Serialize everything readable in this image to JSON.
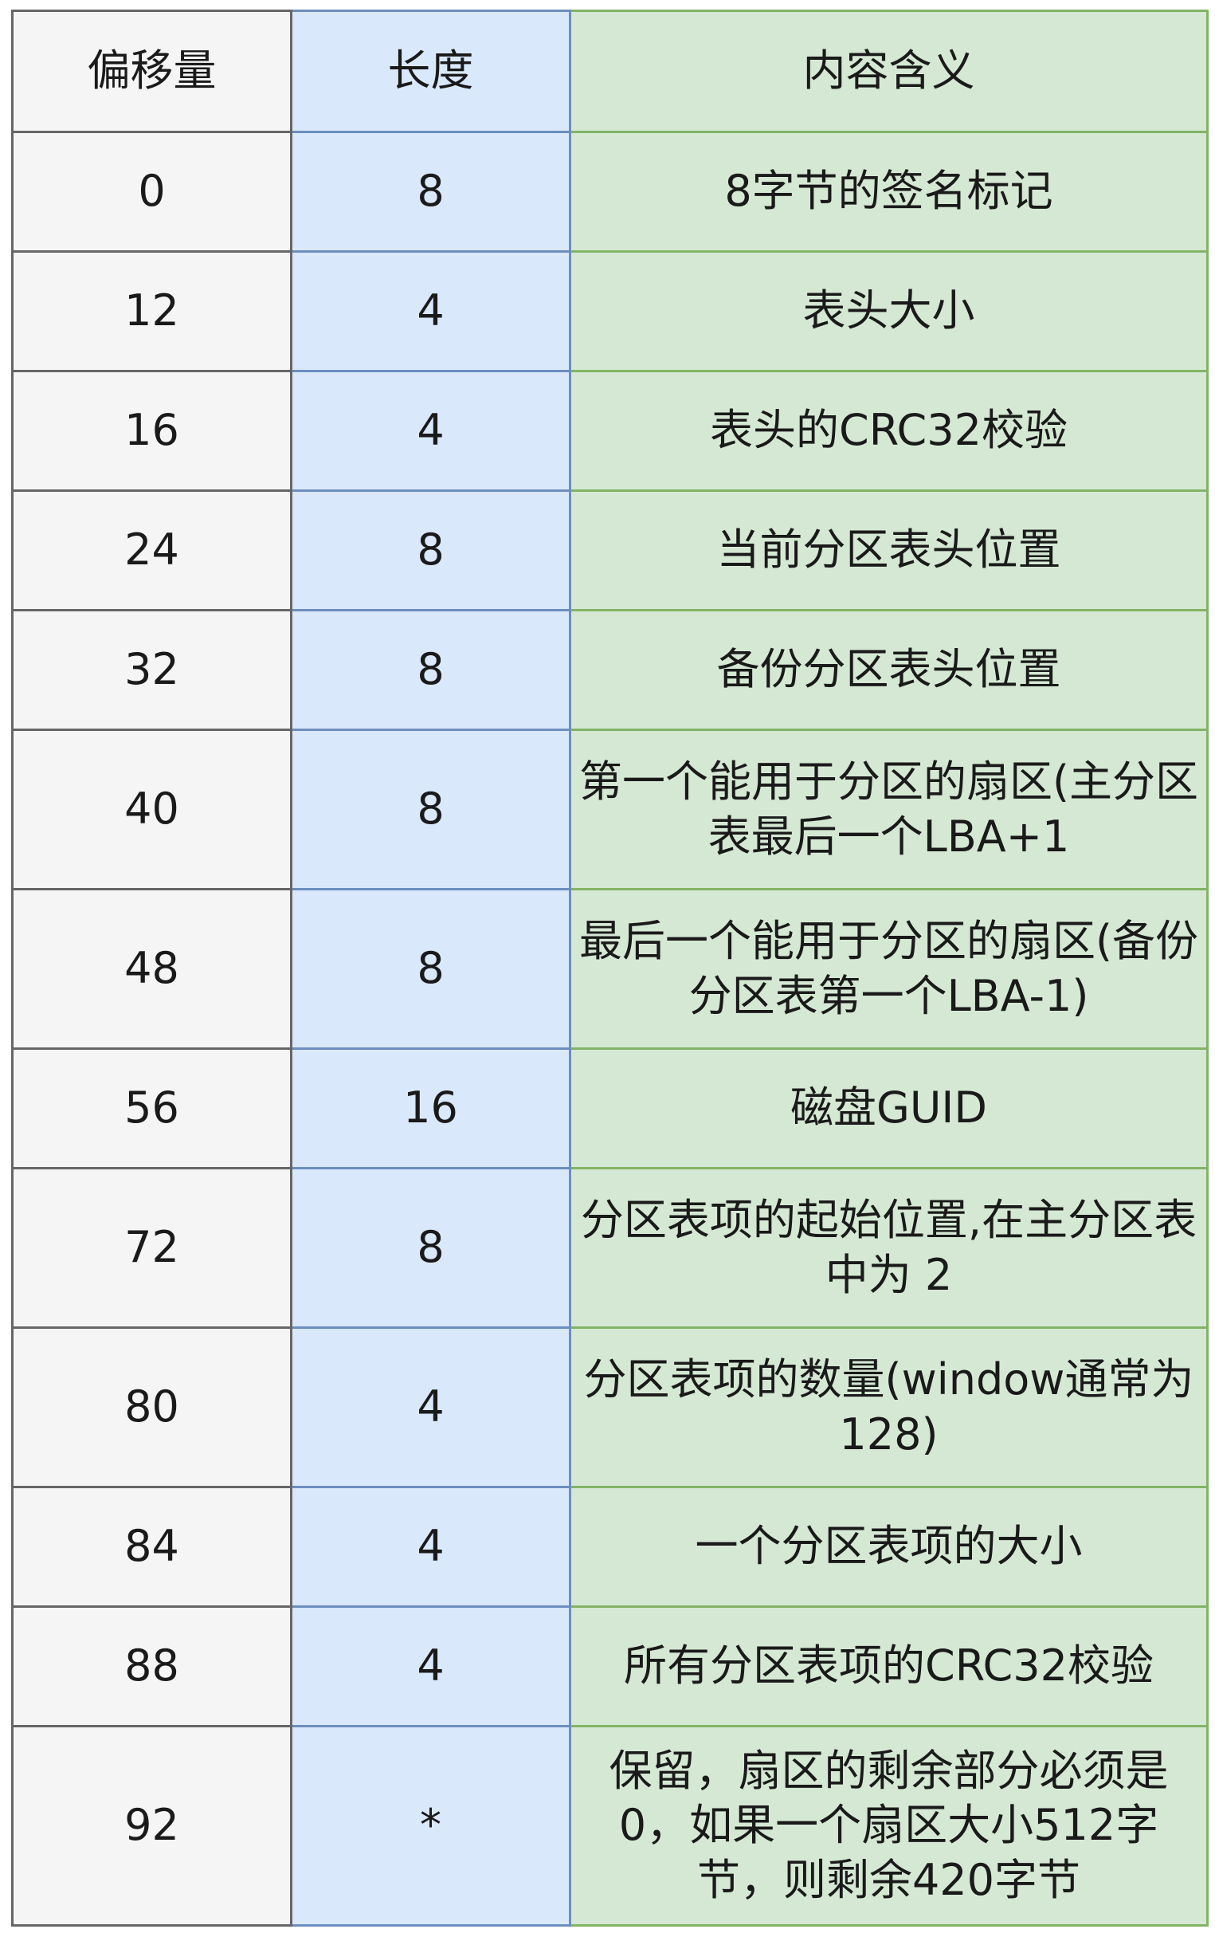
{
  "table": {
    "headers": [
      "偏移量",
      "长度",
      "内容含义"
    ],
    "rows": [
      [
        "0",
        "8",
        "8字节的签名标记"
      ],
      [
        "12",
        "4",
        "表头大小"
      ],
      [
        "16",
        "4",
        "表头的CRC32校验"
      ],
      [
        "24",
        "8",
        "当前分区表头位置"
      ],
      [
        "32",
        "8",
        "备份分区表头位置"
      ],
      [
        "40",
        "8",
        "第一个能用于分区的扇区(主分区表最后一个LBA+1"
      ],
      [
        "48",
        "8",
        "最后一个能用于分区的扇区(备份分区表第一个LBA-1)"
      ],
      [
        "56",
        "16",
        "磁盘GUID"
      ],
      [
        "72",
        "8",
        "分区表项的起始位置,在主分区表中为 2"
      ],
      [
        "80",
        "4",
        "分区表项的数量(window通常为128)"
      ],
      [
        "84",
        "4",
        "一个分区表项的大小"
      ],
      [
        "88",
        "4",
        "所有分区表项的CRC32校验"
      ],
      [
        "92",
        "*",
        "保留，扇区的剩余部分必须是0，如果一个扇区大小512字节，则剩余420字节"
      ]
    ]
  },
  "colors": {
    "offset_fill": "#f5f5f5",
    "offset_stroke": "#666666",
    "length_fill": "#dae8fc",
    "length_stroke": "#6c8ebf",
    "meaning_fill": "#d5e8d4",
    "meaning_stroke": "#82b366"
  }
}
